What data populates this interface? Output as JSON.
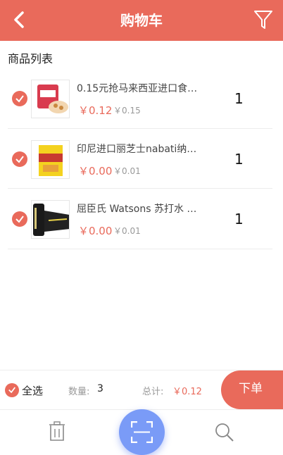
{
  "header": {
    "title": "购物车",
    "back_icon": "back-arrow-icon",
    "filter_icon": "filter-icon"
  },
  "section": {
    "title": "商品列表"
  },
  "items": [
    {
      "name": "0.15元抢马来西亚进口食…",
      "price": "￥0.12",
      "original_price": "￥0.15",
      "quantity": "1",
      "selected": true
    },
    {
      "name": "印尼进口丽芝士nabati纳…",
      "price": "￥0.00",
      "original_price": "￥0.01",
      "quantity": "1",
      "selected": true
    },
    {
      "name": "屈臣氏 Watsons 苏打水 …",
      "price": "￥0.00",
      "original_price": "￥0.01",
      "quantity": "1",
      "selected": true
    }
  ],
  "summary": {
    "select_all_label": "全选",
    "count_label": "数量:",
    "count_value": "3",
    "total_label": "总计:",
    "total_value": "￥0.12",
    "order_button": "下单"
  },
  "bottom_nav": {
    "left_icon": "trash-icon",
    "center_icon": "scan-icon",
    "right_icon": "search-icon"
  },
  "colors": {
    "accent": "#e96a5b",
    "scan_button": "#7a9bf7"
  }
}
